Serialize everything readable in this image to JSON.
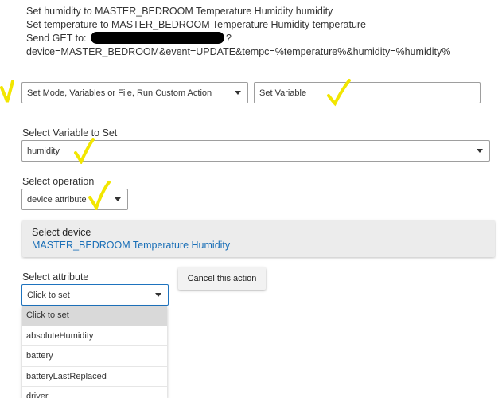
{
  "action_text": {
    "line1": "Set humidity to MASTER_BEDROOM Temperature Humidity humidity",
    "line2": "Set temperature to MASTER_BEDROOM Temperature Humidity temperature",
    "line3_prefix": "Send GET to:",
    "line3_suffix": "?",
    "line4": "device=MASTER_BEDROOM&event=UPDATE&tempc=%temperature%&humidity=%humidity%"
  },
  "action_type_select": {
    "value": "Set Mode, Variables or File, Run Custom Action"
  },
  "action_subtype_select": {
    "value": "Set Variable"
  },
  "variable": {
    "label": "Select Variable to Set",
    "value": "humidity"
  },
  "operation": {
    "label": "Select operation",
    "value": "device attribute"
  },
  "device": {
    "label": "Select device",
    "value": "MASTER_BEDROOM Temperature Humidity"
  },
  "attribute": {
    "label": "Select attribute",
    "value": "Click to set",
    "options": [
      "Click to set",
      "absoluteHumidity",
      "battery",
      "batteryLastReplaced",
      "driver"
    ]
  },
  "cancel_button": {
    "label": "Cancel this action"
  },
  "colors": {
    "annotation": "#f2e600",
    "link": "#1a6fb7",
    "focus_border": "#1e73be"
  },
  "icons": {
    "annotation_mark": "checkmark-annotation-icon",
    "dropdown": "caret-down-icon"
  }
}
